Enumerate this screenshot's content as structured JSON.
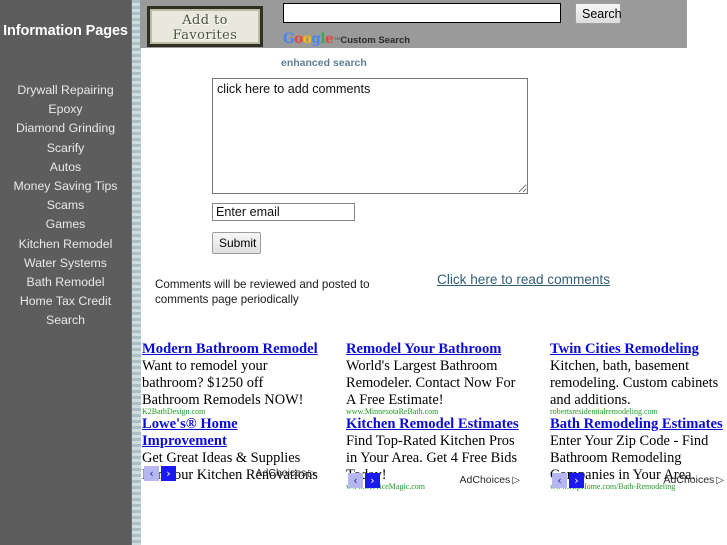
{
  "sidebar": {
    "title": "Information Pages",
    "background": "#5d5d5d",
    "items": [
      {
        "label": "Drywall Repairing"
      },
      {
        "label": "Epoxy"
      },
      {
        "label": "Diamond Grinding"
      },
      {
        "label": "Scarify"
      },
      {
        "label": "Autos"
      },
      {
        "label": "Money Saving Tips"
      },
      {
        "label": "Scams"
      },
      {
        "label": "Games"
      },
      {
        "label": "Kitchen Remodel"
      },
      {
        "label": "Water Systems"
      },
      {
        "label": "Bath Remodel"
      },
      {
        "label": "Home Tax Credit"
      },
      {
        "label": "Search"
      }
    ]
  },
  "header": {
    "favorites_button_line1": "Add to",
    "favorites_button_line2": "Favorites",
    "favorites_icon": "bookmark-star-icon",
    "search": {
      "value": "",
      "placeholder": "",
      "button_label": "Search",
      "brand_logo": "google-logo",
      "brand_text": "Custom Search",
      "brand_tm": "™",
      "enhanced_search_label": "enhanced search",
      "background": "#9a9a9a"
    }
  },
  "form": {
    "comment_value": "click here to add comments",
    "comment_placeholder": "click here to add comments",
    "email_value": "Enter email",
    "email_placeholder": "Enter email",
    "submit_label": "Submit",
    "notice": "Comments will be reviewed and posted to comments page periodically",
    "read_comments_label": "Click here to read comments"
  },
  "ads": {
    "link_color": "#0b0bd6",
    "url_color": "#1f9a22",
    "adchoices_label": "AdChoices",
    "prev_icon": "chevron-left-icon",
    "next_icon": "chevron-right-icon",
    "prev_glyph": "‹",
    "next_glyph": "›",
    "adchoices_glyph": "▷",
    "columns": [
      {
        "blocks": [
          {
            "title": "Modern Bathroom Remodel",
            "desc": "Want to remodel your bathroom? $1250 off Bathroom Remodels NOW!",
            "url": "K2BathDesign.com"
          },
          {
            "title": "Lowe's® Home Improvement",
            "desc": "Get Great Ideas & Supplies For Your Kitchen Renovations",
            "url": ""
          }
        ]
      },
      {
        "blocks": [
          {
            "title": "Remodel Your Bathroom",
            "desc": "World's Largest Bathroom Remodeler. Contact Now For A Free Estimate!",
            "url": "www.MinnesotaReBath.com"
          },
          {
            "title": "Kitchen Remodel Estimates",
            "desc": "Find Top-Rated Kitchen Pros in Your Area. Get 4 Free Bids Today!",
            "url": "www.ServiceMagic.com"
          }
        ]
      },
      {
        "blocks": [
          {
            "title": "Twin Cities Remodeling",
            "desc": "Kitchen, bath, basement remodeling. Custom cabinets and additions.",
            "url": "robertsresidentialremodeling.com"
          },
          {
            "title": "Bath Remodeling Estimates",
            "desc": "Enter Your Zip Code - Find Bathroom Remodeling Companies in Your Area.",
            "url": "www.HipHome.com/Bath-Remodeling"
          }
        ]
      }
    ]
  }
}
